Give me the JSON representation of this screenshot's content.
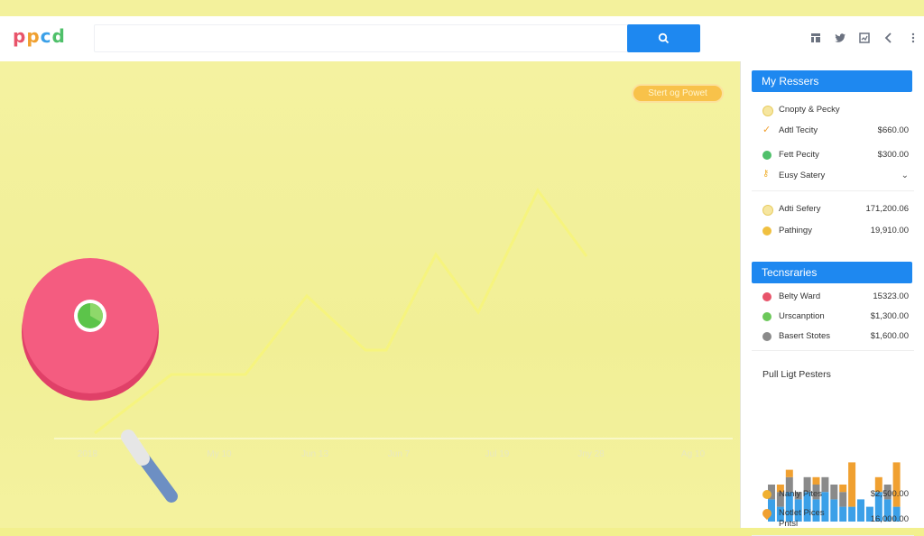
{
  "header": {
    "logo_letters": [
      {
        "ch": "p",
        "color": "#e8546a"
      },
      {
        "ch": "p",
        "color": "#f0a030"
      },
      {
        "ch": "c",
        "color": "#3ba0e8"
      },
      {
        "ch": "d",
        "color": "#4fc06a"
      }
    ],
    "search": {
      "value": "",
      "placeholder": "",
      "button_icon": "search-icon"
    },
    "icons": [
      "grid-icon",
      "twitter-icon",
      "image-icon",
      "chevron-left-icon",
      "more-vertical-icon"
    ]
  },
  "main": {
    "cta_label": "Stert og Powet",
    "x_ticks": [
      "2018",
      "My 10",
      "Jun 13",
      "Jun 7",
      "Jul 19",
      "Jny 28",
      "Ag 10"
    ],
    "chart_data": {
      "type": "line",
      "x": [
        "2018",
        "My 10",
        "Jun 13",
        "Jun 7",
        "Jul 19",
        "Jny 28",
        "Ag 10"
      ],
      "values": [
        0.2,
        0.4,
        0.8,
        0.55,
        1.0,
        1.3,
        0.0
      ],
      "line_color": "#f6f47e"
    },
    "illustration": {
      "name": "magnifier-with-pie",
      "accent": "#f0527a",
      "handle": "#6d8fc3",
      "pie": "#5cc44a"
    }
  },
  "panel": {
    "section1": {
      "title": "My Ressers",
      "rows": [
        {
          "icon": "circle-icon",
          "color": "#f6d77a",
          "label": "Cnopty & Pecky",
          "value": ""
        },
        {
          "icon": "check-icon",
          "color": "#f0a030",
          "label": "Adtl Tecity",
          "value": "$660.00"
        },
        {
          "icon": "circle-icon",
          "color": "#4fc06a",
          "label": "Fett Pecity",
          "value": "$300.00"
        },
        {
          "icon": "key-icon",
          "color": "#f0b030",
          "label": "Eusy Satery",
          "value": "⌄"
        },
        {
          "icon": "circle-icon",
          "color": "#f6d77a",
          "label": "Adti Sefery",
          "value": "171,200.06"
        },
        {
          "icon": "circle-icon",
          "color": "#f0b830",
          "label": "Pathingy",
          "value": "19,910.00"
        }
      ]
    },
    "section2": {
      "title": "Tecnsraries",
      "rows": [
        {
          "icon": "circle-icon",
          "color": "#e8546a",
          "label": "Belty Ward",
          "value": "15323.00"
        },
        {
          "icon": "circle-icon",
          "color": "#6cc85a",
          "label": "Urscanption",
          "value": "$1,300.00"
        },
        {
          "icon": "circle-icon",
          "color": "#8a8a8a",
          "label": "Basert Stotes",
          "value": "$1,600.00"
        }
      ]
    },
    "section3": {
      "title": "Pull Ligt Pesters",
      "chart_data": {
        "type": "bar",
        "series": [
          {
            "name": "",
            "color": "#3ba0e8",
            "values": [
              3,
              2,
              4,
              3,
              4,
              3,
              4,
              3,
              2,
              2,
              3,
              2,
              4,
              3,
              2
            ]
          },
          {
            "name": "",
            "color": "#8a8a8a",
            "values": [
              2,
              2,
              2,
              1,
              2,
              2,
              2,
              2,
              2,
              0,
              0,
              0,
              0,
              2,
              0
            ]
          },
          {
            "name": "",
            "color": "#f0a030",
            "values": [
              0,
              1,
              1,
              0,
              0,
              1,
              0,
              0,
              1,
              6,
              0,
              0,
              2,
              0,
              6
            ]
          }
        ]
      }
    },
    "section4": {
      "rows": [
        {
          "icon": "circle-icon",
          "color": "#f0b030",
          "label": "Nanly Pites",
          "value": "$2,500.00"
        },
        {
          "icon": "drop-icon",
          "color": "#f0a030",
          "label": "Notlet Pices",
          "value": "16,000.00"
        },
        {
          "icon": "",
          "color": "",
          "label": "Pntsl",
          "value": ""
        }
      ]
    }
  }
}
